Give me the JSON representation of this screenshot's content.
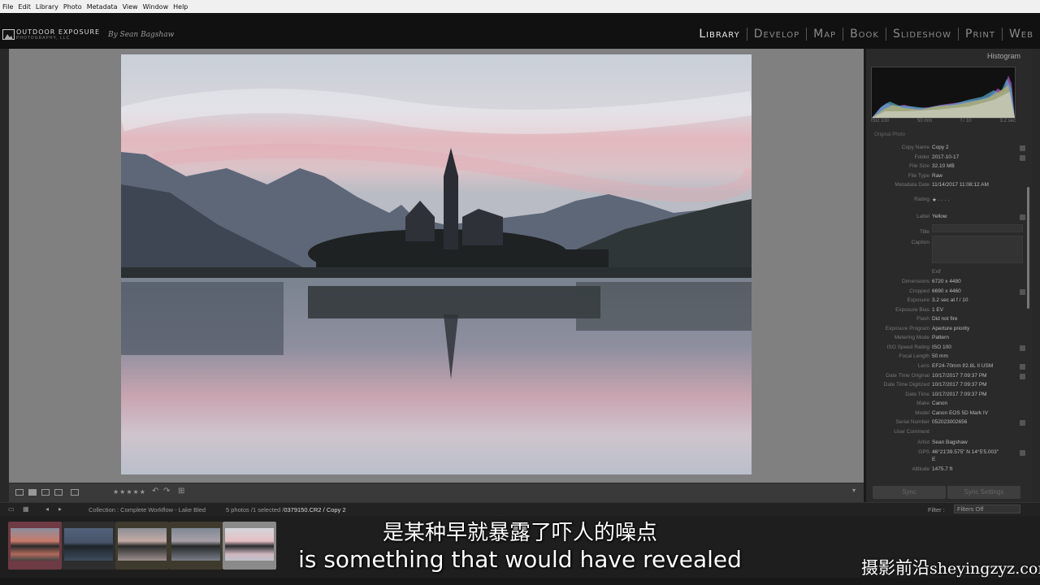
{
  "menu": [
    "File",
    "Edit",
    "Library",
    "Photo",
    "Metadata",
    "View",
    "Window",
    "Help"
  ],
  "identity": {
    "line1": "OUTDOOR EXPOSURE",
    "line2": "PHOTOGRAPHY, LLC",
    "by": "By Sean Bagshaw"
  },
  "modules": [
    {
      "label": "Library",
      "active": true
    },
    {
      "label": "Develop",
      "active": false
    },
    {
      "label": "Map",
      "active": false
    },
    {
      "label": "Book",
      "active": false
    },
    {
      "label": "Slideshow",
      "active": false
    },
    {
      "label": "Print",
      "active": false
    },
    {
      "label": "Web",
      "active": false
    }
  ],
  "panel": {
    "histogram_title": "Histogram",
    "histogram_info": [
      "ISO 100",
      "50 mm",
      "f / 10",
      "3.2 sec"
    ],
    "original_photo": "Original Photo",
    "metadata": [
      {
        "label": "Copy Name",
        "value": "Copy 2"
      },
      {
        "label": "Folder",
        "value": "2017-10-17"
      },
      {
        "label": "File Size",
        "value": "32.10 MB"
      },
      {
        "label": "File Type",
        "value": "Raw"
      },
      {
        "label": "Metadata Date",
        "value": "11/14/2017 11:08:12 AM"
      },
      {
        "label": "Rating",
        "value": "★ · · · ·"
      },
      {
        "label": "Label",
        "value": "Yellow"
      },
      {
        "label": "Title",
        "value": ""
      },
      {
        "label": "Caption",
        "value": ""
      },
      {
        "label": "",
        "value": "Exif"
      },
      {
        "label": "Dimensions",
        "value": "6720 x 4480"
      },
      {
        "label": "Cropped",
        "value": "6690 x 4460"
      },
      {
        "label": "Exposure",
        "value": "3.2 sec at f / 10"
      },
      {
        "label": "Exposure Bias",
        "value": "1 EV"
      },
      {
        "label": "Flash",
        "value": "Did not fire"
      },
      {
        "label": "Exposure Program",
        "value": "Aperture priority"
      },
      {
        "label": "Metering Mode",
        "value": "Pattern"
      },
      {
        "label": "ISO Speed Rating",
        "value": "ISO 100"
      },
      {
        "label": "Focal Length",
        "value": "50 mm"
      },
      {
        "label": "Lens",
        "value": "EF24-70mm f/2.8L II USM"
      },
      {
        "label": "Date Time Original",
        "value": "10/17/2017 7:09:37 PM"
      },
      {
        "label": "Date Time Digitized",
        "value": "10/17/2017 7:09:37 PM"
      },
      {
        "label": "Date Time",
        "value": "10/17/2017 7:09:37 PM"
      },
      {
        "label": "Make",
        "value": "Canon"
      },
      {
        "label": "Model",
        "value": "Canon EOS 5D Mark IV"
      },
      {
        "label": "Serial Number",
        "value": "052023002656"
      },
      {
        "label": "User Comment",
        "value": ""
      },
      {
        "label": "Artist",
        "value": "Sean Bagshaw"
      },
      {
        "label": "GPS",
        "value": "46°21'39.575\" N 14°5'5.003\""
      },
      {
        "label": "",
        "value": "E"
      },
      {
        "label": "Altitude",
        "value": "1475.7 ft"
      }
    ],
    "sync_label": "Sync",
    "sync_settings_label": "Sync Settings"
  },
  "toolbar": {
    "stars": "★★★★★"
  },
  "filmstrip": {
    "source": "Collection : Complete Workflow - Lake Bled",
    "count": "5 photos /1 selected /",
    "filename": "0379150.CR2 / Copy 2",
    "filter_label": "Filter :",
    "filter_value": "Filters Off"
  },
  "subtitles": {
    "zh": "是某种早就暴露了吓人的噪点",
    "en": "is something that would have revealed"
  },
  "watermark": {
    "zh": "摄影前沿",
    "en": "sheyingzyz.com"
  },
  "colors": {
    "accent": "#e6e6e6",
    "panel": "#2a2a2a",
    "canvas": "#808080"
  }
}
